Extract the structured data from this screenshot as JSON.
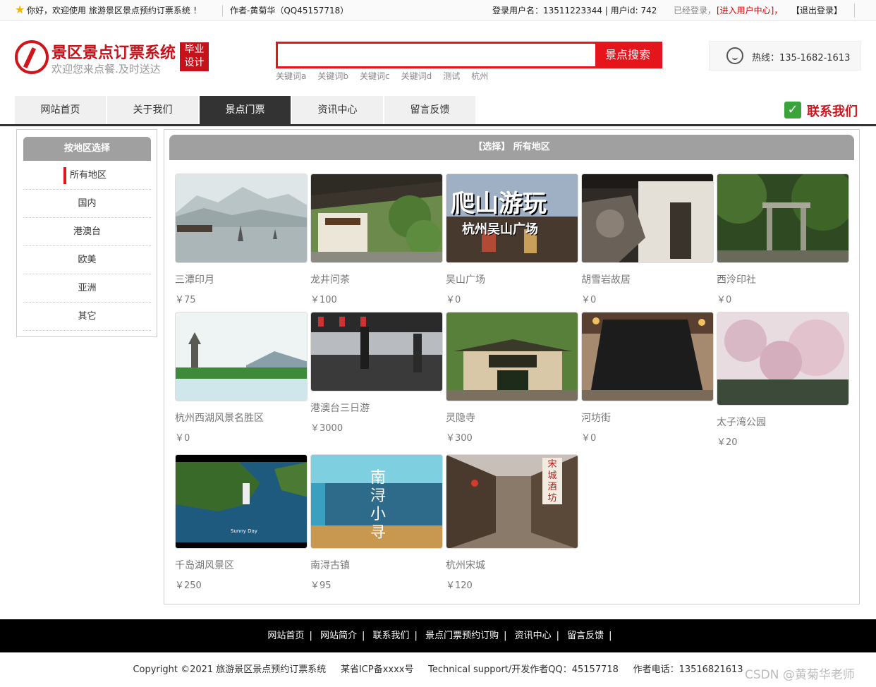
{
  "topbar": {
    "welcome": "你好，欢迎使用 旅游景区景点预约订票系统 ！",
    "author": "作者-黄菊华（QQ45157718）",
    "userinfo": "登录用户名：13511223344 | 用户id: 742",
    "logged": "已经登录，",
    "enter_center": "[进入用户中心]，",
    "logout": "【退出登录】"
  },
  "header": {
    "title": "景区景点订票系统",
    "subtitle": "欢迎您来点餐.及时送达",
    "badge_line1": "毕业",
    "badge_line2": "设计",
    "search_placeholder": "",
    "search_button": "景点搜索",
    "keywords": [
      "关键词a",
      "关键词b",
      "关键词c",
      "关键词d",
      "测试",
      "杭州"
    ],
    "hotline": "热线：135-1682-1613"
  },
  "nav": {
    "items": [
      "网站首页",
      "关于我们",
      "景点门票",
      "资讯中心",
      "留言反馈"
    ],
    "active_index": 2,
    "contact": "联系我们"
  },
  "sidebar": {
    "title": "按地区选择",
    "items": [
      "所有地区",
      "国内",
      "港澳台",
      "欧美",
      "亚洲",
      "其它"
    ],
    "active_index": 0
  },
  "main": {
    "title": "【选择】 所有地区",
    "spots": [
      {
        "name": "三潭印月",
        "price": "￥75"
      },
      {
        "name": "龙井问茶",
        "price": "￥100"
      },
      {
        "name": "吴山广场",
        "price": "￥0",
        "image_text": "爬山游玩",
        "image_sub": "杭州吴山广场"
      },
      {
        "name": "胡雪岩故居",
        "price": "￥0"
      },
      {
        "name": "西泠印社",
        "price": "￥0"
      },
      {
        "name": "杭州西湖风景名胜区",
        "price": "￥0"
      },
      {
        "name": "港澳台三日游",
        "price": "￥3000"
      },
      {
        "name": "灵隐寺",
        "price": "￥300"
      },
      {
        "name": "河坊街",
        "price": "￥0"
      },
      {
        "name": "太子湾公园",
        "price": "￥20"
      },
      {
        "name": "千岛湖风景区",
        "price": "￥250",
        "image_text": "Sunny Day"
      },
      {
        "name": "南浔古镇",
        "price": "￥95",
        "image_text": "南浔小寻"
      },
      {
        "name": "杭州宋城",
        "price": "￥120",
        "image_text": "宋城酒坊"
      }
    ]
  },
  "footer": {
    "links": [
      "网站首页",
      "网站简介",
      "联系我们",
      "景点门票预约订购",
      "资讯中心",
      "留言反馈"
    ],
    "copyright": "Copyright ©2021 旅游景区景点预约订票系统     某省ICP备xxxx号     Technical support/开发作者QQ：45157718     作者电话：13516821613",
    "watermark": "CSDN @黄菊华老师"
  },
  "colors": {
    "brand_red": "#e5151c",
    "nav_active": "#333333",
    "panel_head": "#a0a0a0"
  }
}
